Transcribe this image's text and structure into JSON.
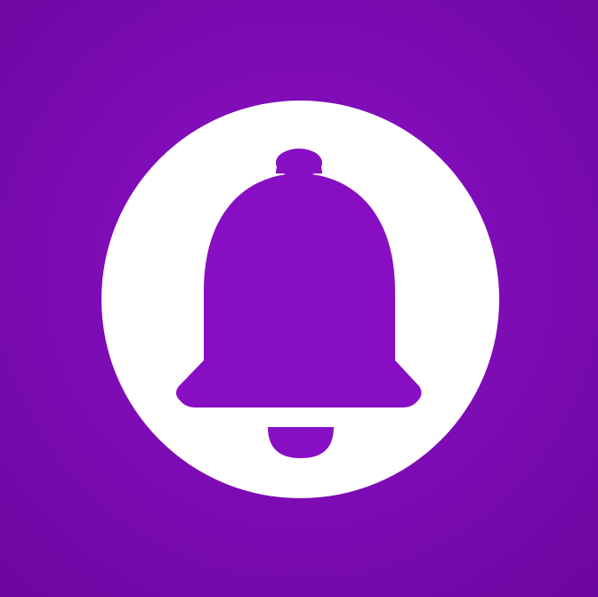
{
  "icon": {
    "name": "bell-icon",
    "background_color": "#7f0cb6",
    "circle_color": "#ffffff",
    "bell_color": "#880ec4"
  }
}
